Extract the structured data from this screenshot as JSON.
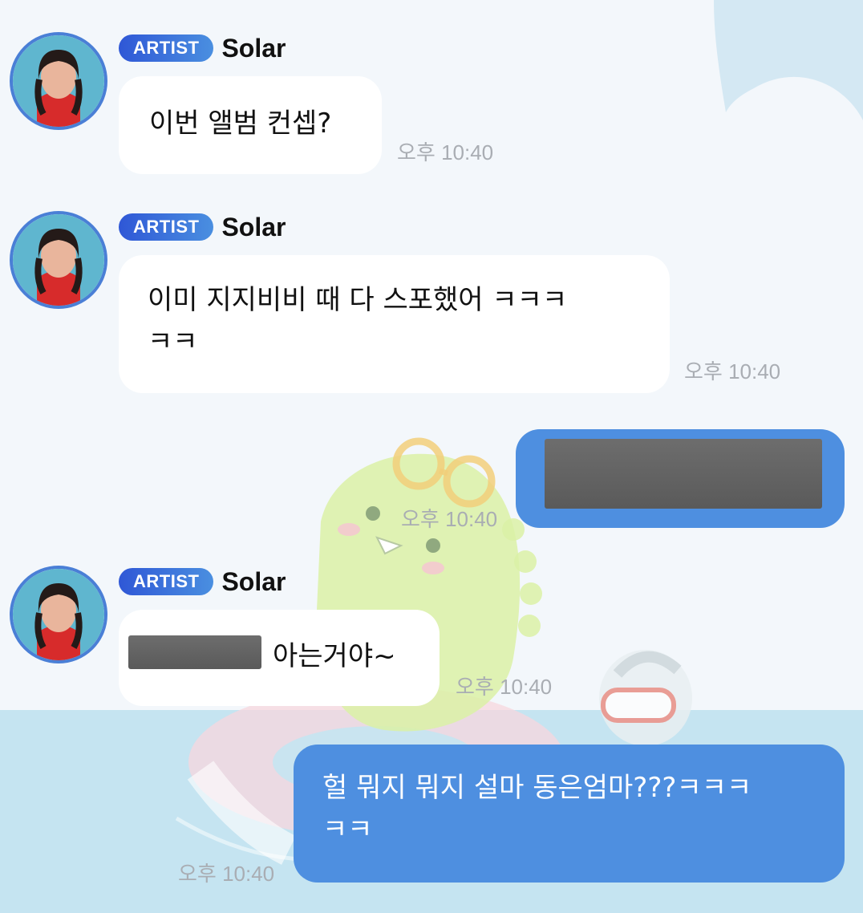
{
  "colors": {
    "artist_badge_start": "#2f57d6",
    "artist_badge_end": "#4a8fe0",
    "my_bubble": "#4e8fe0",
    "their_bubble": "#ffffff",
    "background_top": "#f3f7fb",
    "background_water": "#c5e4f1",
    "timestamp": "#a9adb3"
  },
  "messages": [
    {
      "sender_badge": "ARTIST",
      "sender_name": "Solar",
      "text": "이번 앨범 컨셉?",
      "time": "오후 10:40"
    },
    {
      "sender_badge": "ARTIST",
      "sender_name": "Solar",
      "text_line1": "이미 지지비비 때 다 스포했어 ㅋㅋㅋ",
      "text_line2": "ㅋㅋ",
      "time": "오후 10:40"
    },
    {
      "from_me": true,
      "content": "redacted",
      "time": "오후 10:40"
    },
    {
      "sender_badge": "ARTIST",
      "sender_name": "Solar",
      "text_after_redaction": "아는거야~",
      "time": "오후 10:40"
    },
    {
      "from_me": true,
      "text_line1": "헐 뭐지 뭐지 설마 동은엄마???ㅋㅋㅋ",
      "text_line2": "ㅋㅋ",
      "time": "오후 10:40"
    }
  ]
}
